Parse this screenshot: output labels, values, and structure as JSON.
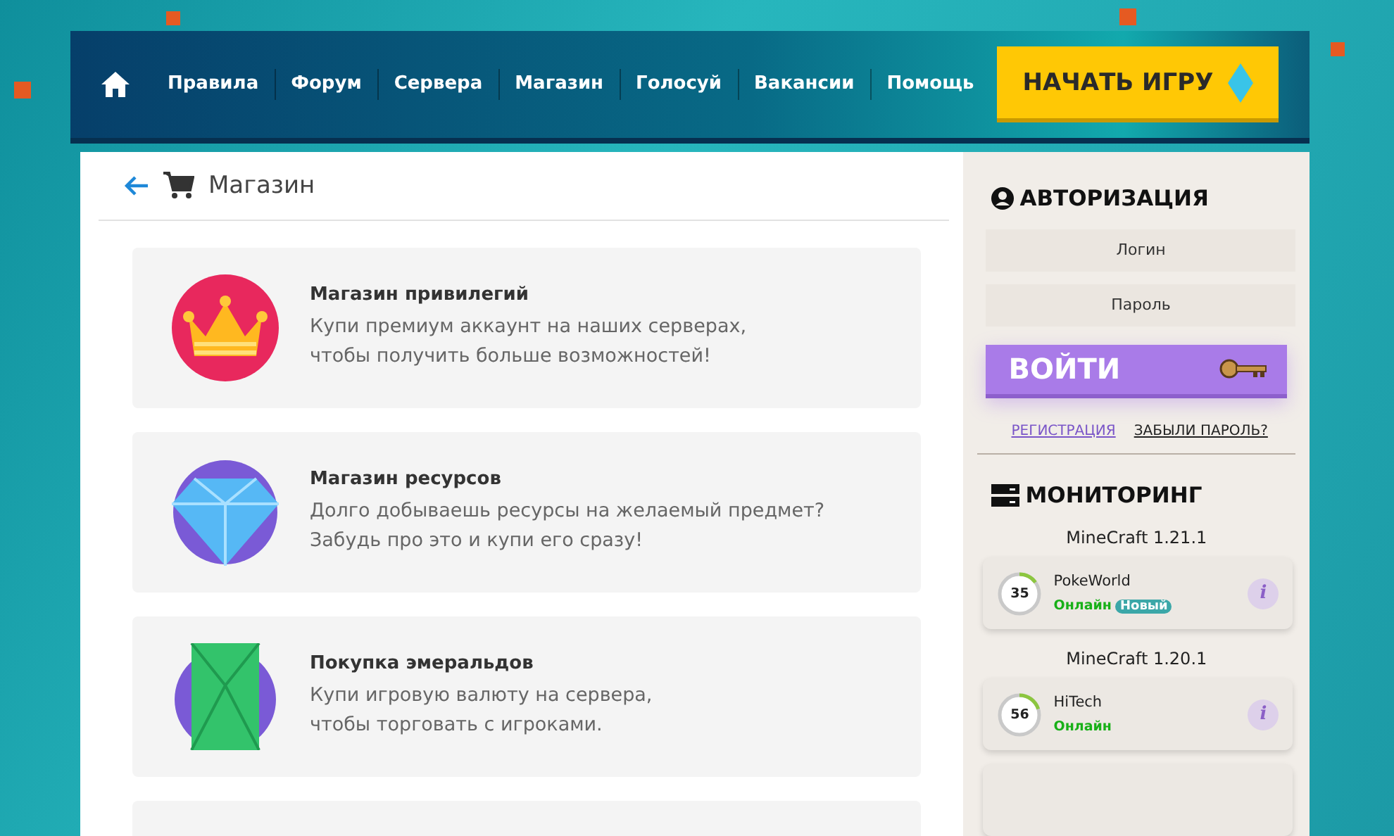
{
  "nav": {
    "items": [
      "Правила",
      "Форум",
      "Сервера",
      "Магазин",
      "Голосуй",
      "Вакансии",
      "Помощь"
    ],
    "cta": "НАЧАТЬ ИГРУ"
  },
  "page": {
    "title": "Магазин"
  },
  "shop_items": [
    {
      "kind": "crown",
      "title": "Магазин привилегий",
      "lines": [
        "Купи премиум аккаунт на наших серверах,",
        "чтобы получить больше возможностей!"
      ]
    },
    {
      "kind": "diamond",
      "title": "Магазин ресурсов",
      "lines": [
        "Долго добываешь ресурсы на желаемый предмет?",
        "Забудь про это и купи его сразу!"
      ]
    },
    {
      "kind": "emerald",
      "title": "Покупка эмеральдов",
      "lines": [
        "Купи игровую валюту на сервера,",
        "чтобы торговать с игроками."
      ]
    }
  ],
  "auth": {
    "title": "АВТОРИЗАЦИЯ",
    "login_placeholder": "Логин",
    "password_placeholder": "Пароль",
    "submit": "ВОЙТИ",
    "register": "РЕГИСТРАЦИЯ",
    "forgot": "ЗАБЫЛИ ПАРОЛЬ?"
  },
  "monitoring": {
    "title": "МОНИТОРИНГ",
    "servers": [
      {
        "version": "MineCraft 1.21.1",
        "name": "PokeWorld",
        "players": "35",
        "level": 0.15,
        "status": "Онлайн",
        "badge": "Новый",
        "info": "i"
      },
      {
        "version": "MineCraft 1.20.1",
        "name": "HiTech",
        "players": "56",
        "level": 0.2,
        "status": "Онлайн",
        "info": "i"
      }
    ]
  }
}
